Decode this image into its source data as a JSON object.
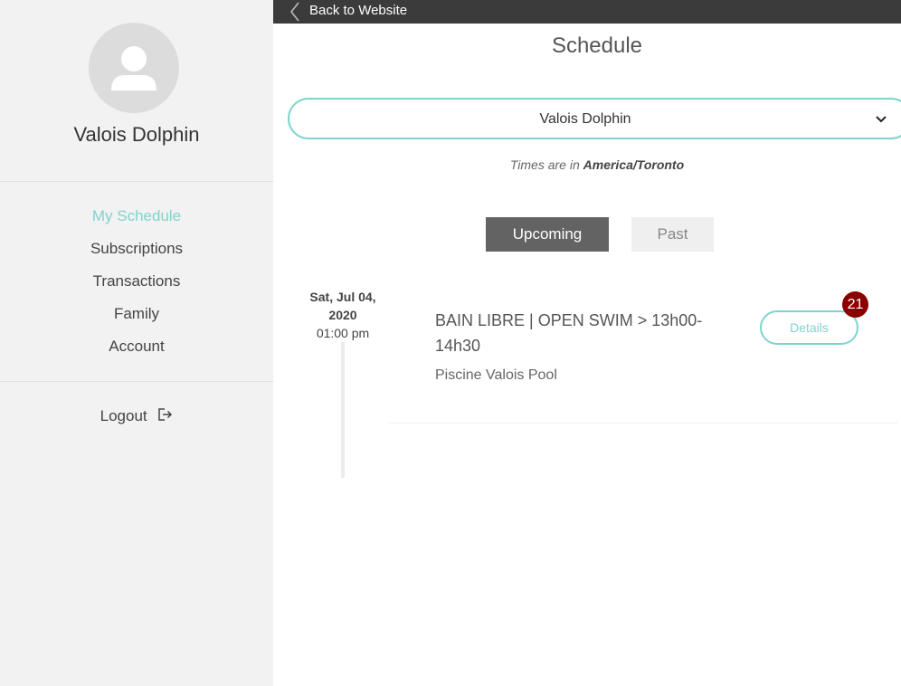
{
  "topbar": {
    "back_label": "Back to Website"
  },
  "sidebar": {
    "profile_name": "Valois Dolphin",
    "nav": [
      {
        "label": "My Schedule",
        "active": true
      },
      {
        "label": "Subscriptions"
      },
      {
        "label": "Transactions"
      },
      {
        "label": "Family"
      },
      {
        "label": "Account"
      }
    ],
    "logout_label": "Logout"
  },
  "main": {
    "title": "Schedule",
    "member_select": {
      "value": "Valois Dolphin"
    },
    "timezone": {
      "prefix": "Times are in",
      "zone": "America/Toronto"
    },
    "tabs": [
      {
        "label": "Upcoming",
        "selected": true
      },
      {
        "label": "Past",
        "selected": false
      }
    ],
    "events": [
      {
        "date": "Sat, Jul 04,",
        "year": "2020",
        "time": "01:00 pm",
        "title": "BAIN LIBRE | OPEN SWIM > 13h00-14h30",
        "location": "Piscine Valois Pool",
        "details_label": "Details",
        "badge": "21"
      }
    ]
  },
  "colors": {
    "accent": "#7fd4cd",
    "topbar": "#3b3b3b",
    "sidebar_bg": "#f2f2f2",
    "badge": "#8b0000"
  }
}
